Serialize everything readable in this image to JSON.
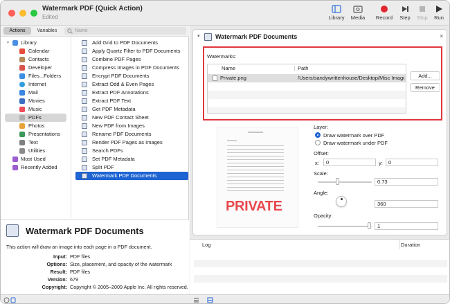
{
  "window": {
    "title": "Watermark PDF (Quick Action)",
    "subtitle": "Edited",
    "traffic_colors": [
      "#fe5f57",
      "#febc2e",
      "#28c840"
    ]
  },
  "toolbar": {
    "library_label": "Library",
    "media_label": "Media",
    "record_label": "Record",
    "step_label": "Step",
    "stop_label": "Stop",
    "run_label": "Run"
  },
  "left": {
    "tab_actions": "Actions",
    "tab_variables": "Variables",
    "search_placeholder": "Name",
    "library": [
      {
        "label": "Library",
        "icon": "library-folder-icon",
        "color": "#4a90e2"
      },
      {
        "label": "Calendar",
        "icon": "calendar-icon",
        "color": "#e74c3c"
      },
      {
        "label": "Contacts",
        "icon": "contacts-icon",
        "color": "#b58b5a"
      },
      {
        "label": "Developer",
        "icon": "developer-icon",
        "color": "#d9534f"
      },
      {
        "label": "Files...Folders",
        "icon": "finder-icon",
        "color": "#3d8ee0"
      },
      {
        "label": "Internet",
        "icon": "internet-icon",
        "color": "#2f9de0"
      },
      {
        "label": "Mail",
        "icon": "mail-icon",
        "color": "#3b86e0"
      },
      {
        "label": "Movies",
        "icon": "movies-icon",
        "color": "#3a6fc4"
      },
      {
        "label": "Music",
        "icon": "music-icon",
        "color": "#f04d5a"
      },
      {
        "label": "PDFs",
        "icon": "pdf-icon",
        "color": "#b0b0b0"
      },
      {
        "label": "Photos",
        "icon": "photos-icon",
        "color": "#e8a23a"
      },
      {
        "label": "Presentations",
        "icon": "presentations-icon",
        "color": "#3a9a5a"
      },
      {
        "label": "Text",
        "icon": "text-icon",
        "color": "#7f7f7f"
      },
      {
        "label": "Utilities",
        "icon": "utilities-icon",
        "color": "#8a8a8a"
      },
      {
        "label": "Most Used",
        "icon": "most-used-folder-icon",
        "color": "#9b5fd0"
      },
      {
        "label": "Recently Added",
        "icon": "recently-added-folder-icon",
        "color": "#9b5fd0"
      }
    ],
    "actions": [
      "Add Grid to PDF Documents",
      "Apply Quartz Filter to PDF Documents",
      "Combine PDF Pages",
      "Compress Images in PDF Documents",
      "Encrypt PDF Documents",
      "Extract Odd & Even Pages",
      "Extract PDF Annotations",
      "Extract PDF Text",
      "Get PDF Metadata",
      "New PDF Contact Sheet",
      "New PDF from Images",
      "Rename PDF Documents",
      "Render PDF Pages as Images",
      "Search PDFs",
      "Set PDF Metadata",
      "Split PDF",
      "Watermark PDF Documents"
    ]
  },
  "description": {
    "title": "Watermark PDF Documents",
    "text": "This action will draw an image into each page in a PDF document.",
    "rows": [
      {
        "key": "Input:",
        "value": "PDF files"
      },
      {
        "key": "Options:",
        "value": "Size, placement, and opacity of the watermark"
      },
      {
        "key": "Result:",
        "value": "PDF files"
      },
      {
        "key": "Version:",
        "value": "679"
      },
      {
        "key": "Copyright:",
        "value": "Copyright © 2005–2009 Apple Inc. All rights reserved."
      }
    ]
  },
  "action_card": {
    "title": "Watermark PDF Documents",
    "watermarks_label": "Watermarks:",
    "col_name": "Name",
    "col_path": "Path",
    "file_name": "Private.png",
    "file_path": "/Users/sandywrittenhouse/Desktop/Misc Images/Private.png",
    "add_button": "Add...",
    "remove_button": "Remove",
    "preview_watermark": "PRIVATE",
    "layer_label": "Layer:",
    "layer_over": "Draw watermark over PDF",
    "layer_under": "Draw watermark under PDF",
    "offset_label": "Offset:",
    "x_label": "x:",
    "x_value": "0",
    "y_label": "y:",
    "y_value": "0",
    "scale_label": "Scale:",
    "scale_value": "0.73",
    "angle_label": "Angle:",
    "angle_value": "360",
    "opacity_label": "Opacity:",
    "opacity_value": "1",
    "accent_color": "#1f64d3",
    "highlight_color": "#e0363e"
  },
  "log": {
    "col_log": "Log",
    "col_duration": "Duration"
  }
}
